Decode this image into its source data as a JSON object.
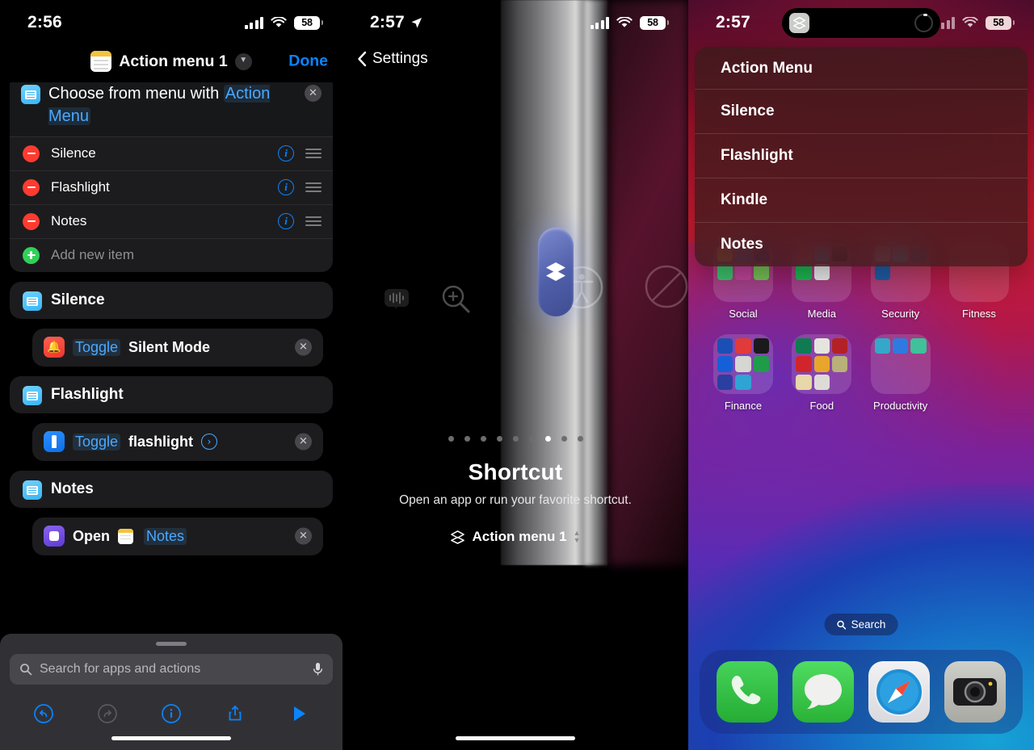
{
  "panel1": {
    "status": {
      "time": "2:56",
      "battery": "58",
      "signal_icon": "cellular-bars-icon",
      "wifi_icon": "wifi-icon"
    },
    "nav": {
      "icon": "notes-app-icon",
      "title": "Action menu 1",
      "chevron": "chevron-down-icon",
      "done_label": "Done"
    },
    "menu_card": {
      "icon": "choose-from-menu-icon",
      "text_before": "Choose from menu with",
      "token": "Action Menu",
      "close_icon": "clear-icon",
      "rows": [
        {
          "label": "Silence",
          "badge": "remove-icon",
          "info": "info-icon",
          "grip": "reorder-grip-icon"
        },
        {
          "label": "Flashlight",
          "badge": "remove-icon",
          "info": "info-icon",
          "grip": "reorder-grip-icon"
        },
        {
          "label": "Notes",
          "badge": "remove-icon",
          "info": "info-icon",
          "grip": "reorder-grip-icon"
        }
      ],
      "add_row": {
        "label": "Add new item",
        "badge": "add-icon"
      }
    },
    "blocks": [
      {
        "head": "Silence",
        "head_icon": "menu-case-icon",
        "action": {
          "app_icon": "silent-mode-icon",
          "verb": "Toggle",
          "object": "Silent Mode",
          "object_is_link": false,
          "has_disclosure": false,
          "close_icon": "clear-icon"
        }
      },
      {
        "head": "Flashlight",
        "head_icon": "menu-case-icon",
        "action": {
          "app_icon": "flashlight-icon",
          "verb": "Toggle",
          "object": "flashlight",
          "object_is_link": false,
          "has_disclosure": true,
          "close_icon": "clear-icon"
        }
      },
      {
        "head": "Notes",
        "head_icon": "menu-case-icon",
        "action": {
          "app_icon": "shortcuts-open-icon",
          "verb": "Open",
          "object": "Notes",
          "object_is_link": true,
          "has_disclosure": false,
          "close_icon": "clear-icon"
        }
      }
    ],
    "sheet": {
      "search_placeholder": "Search for apps and actions",
      "search_icon": "search-icon",
      "mic_icon": "microphone-icon",
      "toolbar": [
        {
          "name": "undo-button",
          "glyph": "undo-icon"
        },
        {
          "name": "redo-button",
          "glyph": "redo-icon"
        },
        {
          "name": "details-button",
          "glyph": "info-icon"
        },
        {
          "name": "share-button",
          "glyph": "share-icon"
        },
        {
          "name": "run-button",
          "glyph": "play-icon"
        }
      ]
    }
  },
  "panel2": {
    "status": {
      "time": "2:57",
      "location_icon": "location-arrow-icon",
      "battery": "58"
    },
    "back": {
      "icon": "chevron-left-icon",
      "label": "Settings"
    },
    "hero": {
      "button_icon": "shortcuts-glyph-icon",
      "dots_total": 9,
      "dots_active_index": 7,
      "title": "Shortcut",
      "subtitle": "Open an app or run your favorite shortcut.",
      "picker_icon": "shortcuts-glyph-icon",
      "picker_value": "Action menu 1",
      "picker_chevrons": "up-down-chevrons-icon"
    }
  },
  "panel3": {
    "status": {
      "time": "2:57",
      "battery": "58"
    },
    "dynamic_island": {
      "app_icon": "shortcuts-glyph-icon",
      "activity_icon": "progress-ring-icon"
    },
    "popup": {
      "title": "Action Menu",
      "items": [
        "Silence",
        "Flashlight",
        "Kindle",
        "Notes"
      ]
    },
    "home": {
      "folders_row1": [
        "Social",
        "Media",
        "Security",
        "Fitness"
      ],
      "folders_row2": [
        "Finance",
        "Food",
        "Productivity"
      ],
      "search_pill": {
        "icon": "search-icon",
        "label": "Search"
      },
      "dock": [
        {
          "name": "dock-phone",
          "label": "Phone",
          "icon": "phone-icon"
        },
        {
          "name": "dock-messages",
          "label": "Messages",
          "icon": "message-bubble-icon"
        },
        {
          "name": "dock-safari",
          "label": "Safari",
          "icon": "compass-icon"
        },
        {
          "name": "dock-camera",
          "label": "Camera",
          "icon": "camera-icon"
        }
      ]
    }
  },
  "colors": {
    "accent_blue": "#0a84ff",
    "destructive_red": "#ff3b30",
    "add_green": "#30d158"
  }
}
